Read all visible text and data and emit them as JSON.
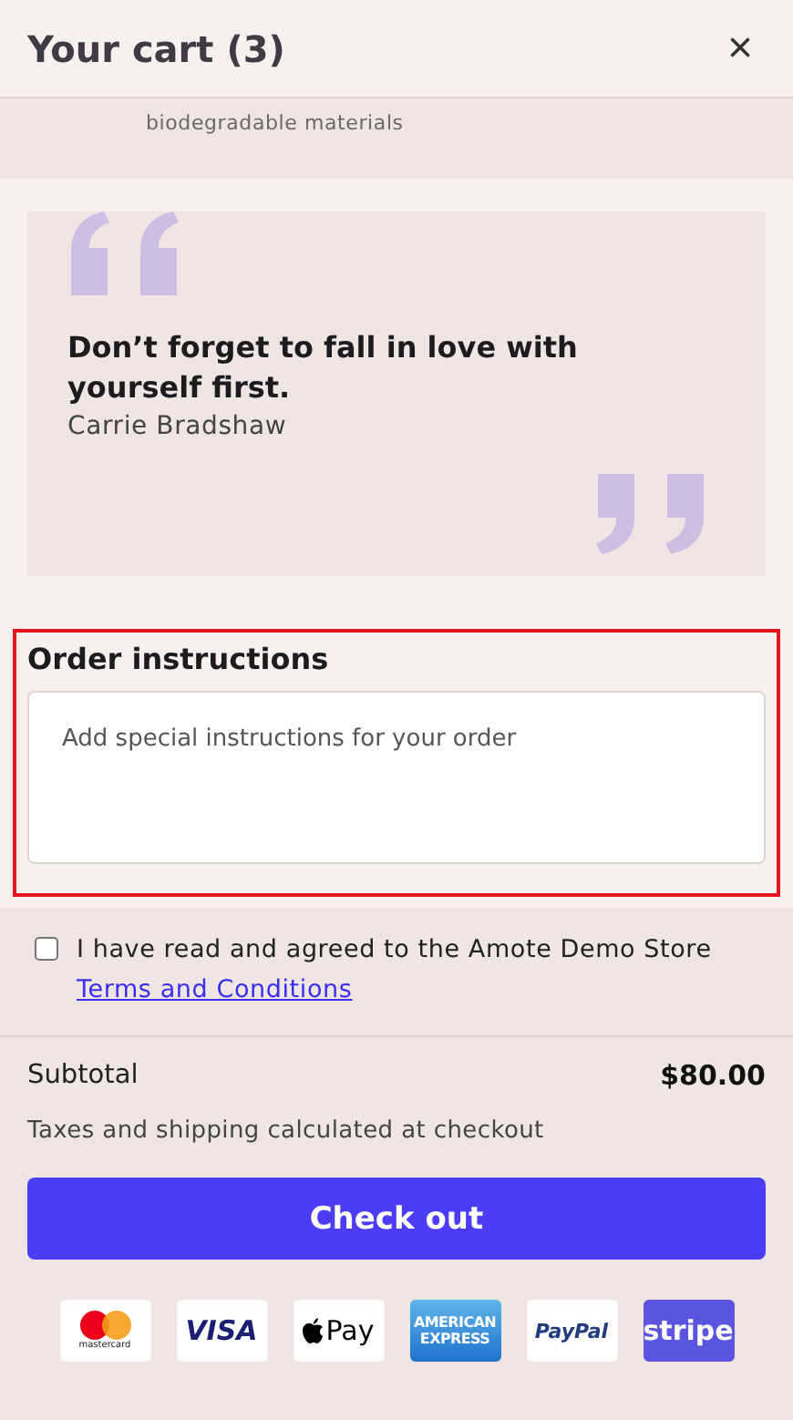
{
  "header": {
    "title": "Your cart (3)",
    "close": "×"
  },
  "notice": {
    "text": "biodegradable materials"
  },
  "quote": {
    "text": "Don’t forget to fall in love with yourself first.",
    "author": "Carrie Bradshaw"
  },
  "order_instructions": {
    "label": "Order instructions",
    "placeholder": "Add special instructions for your order",
    "highlighted": true
  },
  "terms": {
    "checked": false,
    "text": "I have read and agreed to the Amote Demo Store",
    "link": "Terms and Conditions"
  },
  "subtotal": {
    "label": "Subtotal",
    "amount": "$80.00",
    "note": "Taxes and shipping calculated at checkout"
  },
  "checkout": {
    "label": "Check out"
  },
  "payment_methods": [
    {
      "kind": "mastercard",
      "label": "mastercard"
    },
    {
      "kind": "visa",
      "label": "VISA"
    },
    {
      "kind": "applepay",
      "label": "Pay"
    },
    {
      "kind": "amex",
      "label": "AMERICAN EXPRESS"
    },
    {
      "kind": "paypal",
      "label": "PayPal"
    },
    {
      "kind": "stripe",
      "label": "stripe"
    }
  ]
}
